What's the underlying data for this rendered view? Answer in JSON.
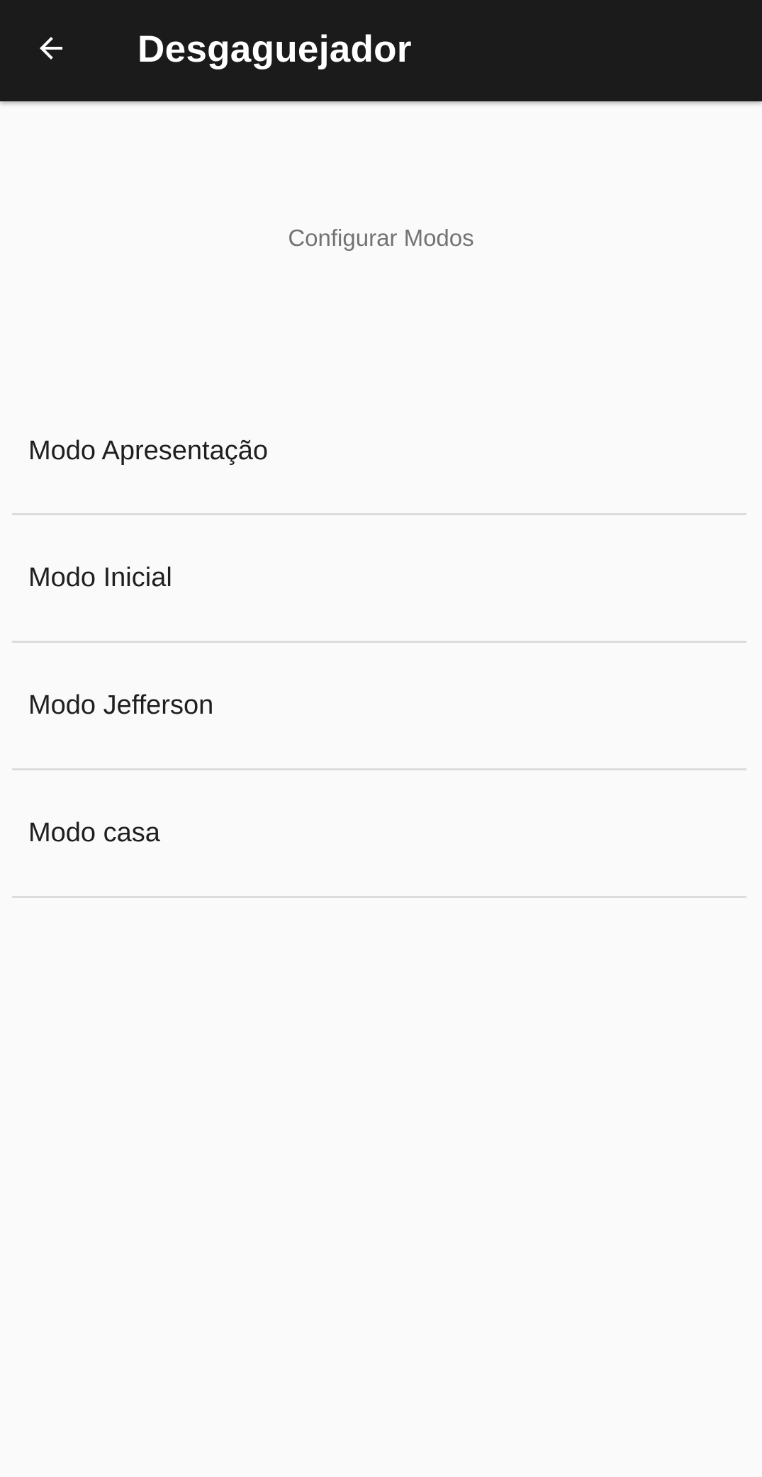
{
  "toolbar": {
    "back_icon": "arrow-back-icon",
    "title": "Desgaguejador"
  },
  "section": {
    "title": "Configurar Modos"
  },
  "modes": {
    "items": [
      {
        "label": "Modo Apresentação"
      },
      {
        "label": "Modo Inicial"
      },
      {
        "label": "Modo Jefferson"
      },
      {
        "label": "Modo casa"
      }
    ]
  },
  "colors": {
    "toolbar_bg": "#1b1b1b",
    "page_bg": "#fafafa",
    "divider": "#dcdcdc",
    "header_text": "#737373",
    "item_text": "#1f1f1f"
  }
}
